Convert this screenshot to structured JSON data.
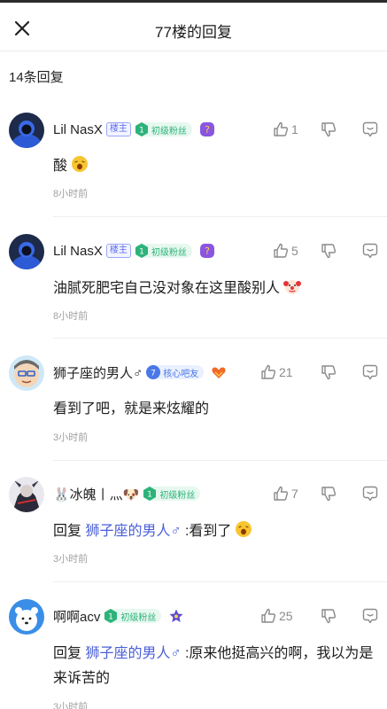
{
  "header": {
    "title": "77楼的回复"
  },
  "reply_count": "14条回复",
  "comments": [
    {
      "username": "Lil NasX",
      "owner_badge": "楼主",
      "fan_level": "1",
      "fan_label": "初级粉丝",
      "likes": "1",
      "text": "酸",
      "time": "8小时前"
    },
    {
      "username": "Lil NasX",
      "owner_badge": "楼主",
      "fan_level": "1",
      "fan_label": "初级粉丝",
      "likes": "5",
      "text": "油腻死肥宅自己没对象在这里酸别人",
      "time": "8小时前"
    },
    {
      "username": "狮子座的男人♂",
      "fan_level": "7",
      "fan_label": "核心吧友",
      "likes": "21",
      "text": "看到了吧，就是来炫耀的",
      "time": "3小时前"
    },
    {
      "username": "🐰冰魄丨灬🐶",
      "fan_level": "1",
      "fan_label": "初级粉丝",
      "likes": "7",
      "reply_prefix": "回复",
      "reply_to": "狮子座的男人♂",
      "text": ":看到了",
      "time": "3小时前"
    },
    {
      "username": "啊啊acv",
      "fan_level": "1",
      "fan_label": "初级粉丝",
      "likes": "25",
      "reply_prefix": "回复",
      "reply_to": "狮子座的男人♂",
      "text": ":原来他挺高兴的啊，我以为是来诉苦的",
      "time": "3小时前"
    }
  ]
}
